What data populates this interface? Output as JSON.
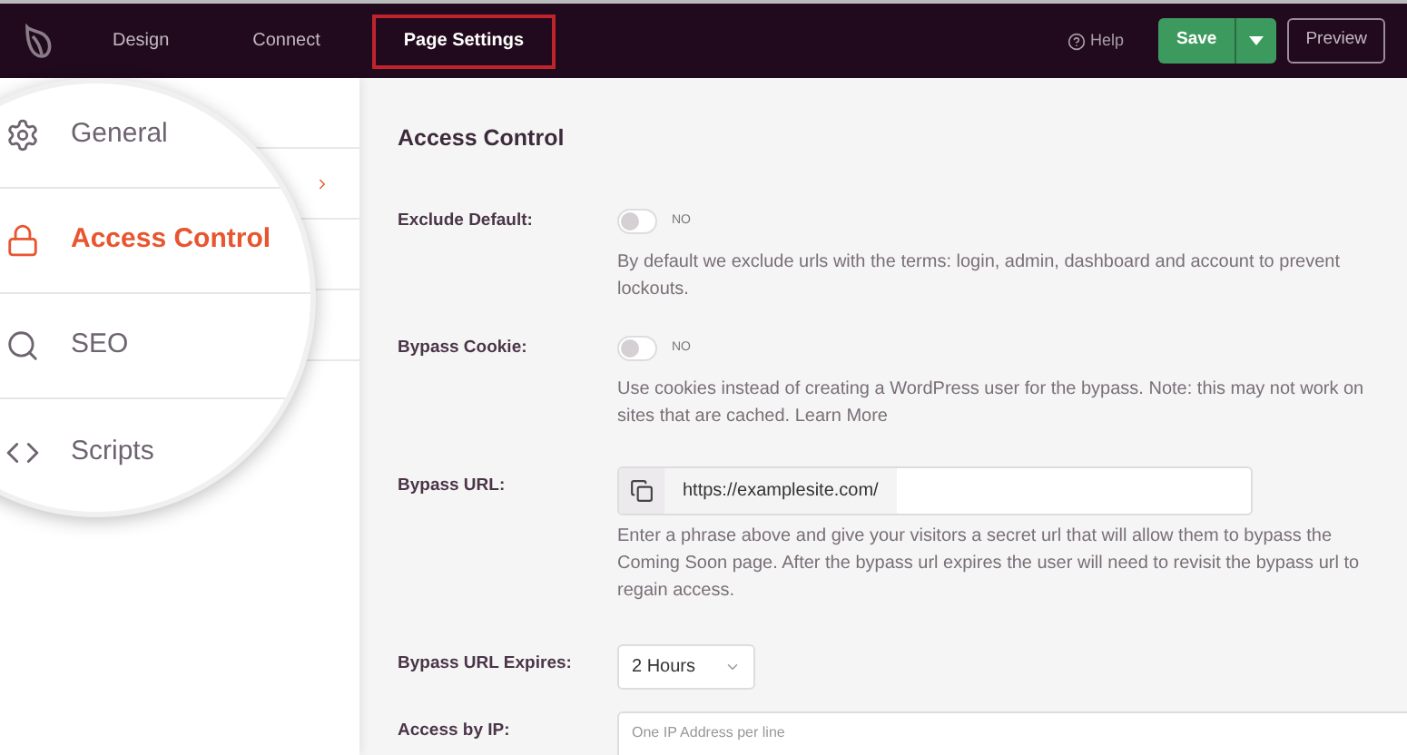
{
  "nav": {
    "tabs": [
      {
        "label": "Design",
        "selected": false
      },
      {
        "label": "Connect",
        "selected": false
      },
      {
        "label": "Page Settings",
        "selected": true
      }
    ],
    "help": "Help",
    "save": "Save",
    "preview": "Preview"
  },
  "magnifier": {
    "items": [
      {
        "kind": "gear",
        "label": "General",
        "selected": false
      },
      {
        "kind": "lock",
        "label": "Access Control",
        "selected": true
      },
      {
        "kind": "search",
        "label": "SEO",
        "selected": false
      },
      {
        "kind": "code",
        "label": "Scripts",
        "selected": false
      }
    ]
  },
  "panel": {
    "title": "Access Control",
    "fields": [
      {
        "kind": "toggle",
        "label": "Exclude Default:",
        "on": false,
        "state_text": "NO",
        "help": "By default we exclude urls with the terms: login, admin, dashboard and account to prevent lockouts."
      },
      {
        "kind": "toggle",
        "label": "Bypass Cookie:",
        "on": false,
        "state_text": "NO",
        "help": "Use cookies instead of creating a WordPress user for the bypass. Note: this may not work on sites that are cached.",
        "link": "Learn More"
      },
      {
        "kind": "url",
        "label": "Bypass URL:",
        "prefix": "https://examplesite.com/",
        "help": "Enter a phrase above and give your visitors a secret url that will allow them to bypass the Coming Soon page. After the bypass url expires the user will need to revisit the bypass url to regain access."
      },
      {
        "kind": "select",
        "label": "Bypass URL Expires:",
        "value": "2 Hours"
      },
      {
        "kind": "textarea",
        "label": "Access by IP:",
        "placeholder": "One IP Address per line"
      }
    ]
  }
}
